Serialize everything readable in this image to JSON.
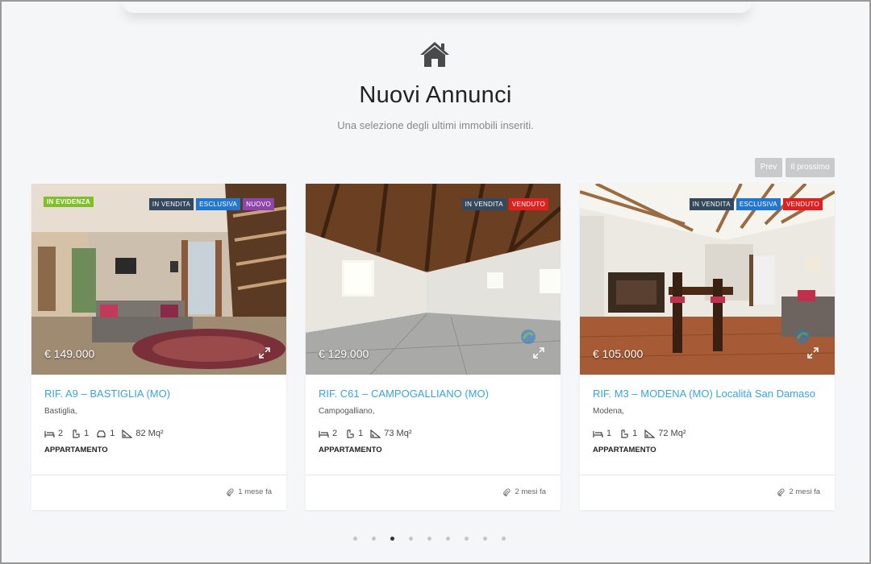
{
  "section": {
    "title": "Nuovi Annunci",
    "subtitle": "Una selezione degli ultimi immobili inseriti.",
    "icon": "home-icon"
  },
  "nav": {
    "prev_label": "Prev",
    "next_label": "Il prossimo"
  },
  "listings": [
    {
      "featured": "IN EVIDENZA",
      "badges": [
        "IN VENDITA",
        "ESCLUSIVA",
        "NUOVO"
      ],
      "price": "€ 149.000",
      "title": "RIF. A9 – BASTIGLIA (MO)",
      "location": "Bastiglia,",
      "beds": "2",
      "baths": "1",
      "garage": "1",
      "area": "82 Mq²",
      "type": "APPARTAMENTO",
      "time": "1 mese fa"
    },
    {
      "badges": [
        "IN VENDITA",
        "VENDUTO"
      ],
      "price": "€ 129.000",
      "title": "RIF. C61 – CAMPOGALLIANO (MO)",
      "location": "Campogalliano,",
      "beds": "2",
      "baths": "1",
      "area": "73 Mq²",
      "type": "APPARTAMENTO",
      "time": "2 mesi fa"
    },
    {
      "badges": [
        "IN VENDITA",
        "ESCLUSIVA",
        "VENDUTO"
      ],
      "price": "€ 105.000",
      "title": "RIF. M3 – MODENA (MO) Località San Damaso",
      "location": "Modena,",
      "beds": "1",
      "baths": "1",
      "area": "72 Mq²",
      "type": "APPARTAMENTO",
      "time": "2 mesi fa"
    }
  ],
  "pagination": {
    "count": 9,
    "active_index": 2
  },
  "colors": {
    "accent": "#3aa3dd",
    "featured": "#7fbf2a",
    "vendita": "#34495e",
    "esclusiva": "#2277cc",
    "nuovo": "#8e44ad",
    "venduto": "#e02020"
  }
}
